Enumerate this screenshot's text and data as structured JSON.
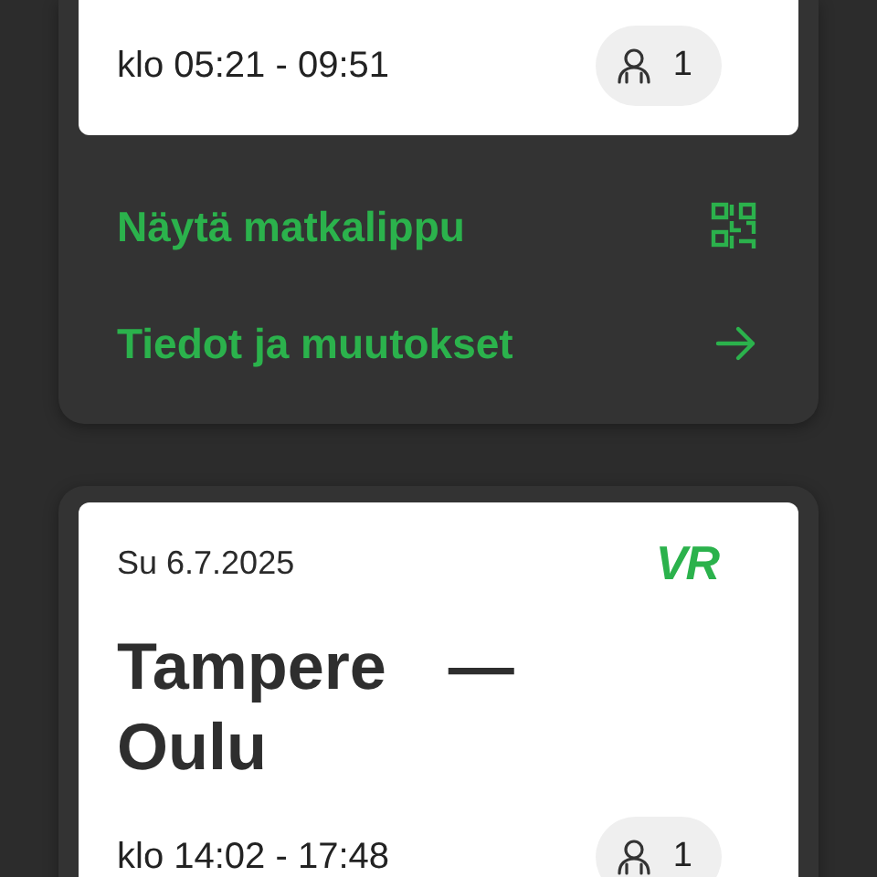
{
  "trips": [
    {
      "time": "klo 05:21 - 09:51",
      "passengers": "1",
      "actions": [
        {
          "label": "Näytä matkalippu",
          "kind": "qr"
        },
        {
          "label": "Tiedot ja muutokset",
          "kind": "arrow"
        }
      ]
    },
    {
      "date": "Su 6.7.2025",
      "logo": "VR",
      "route": "Tampere — Oulu",
      "time": "klo 14:02 - 17:48",
      "passengers": "1"
    }
  ]
}
